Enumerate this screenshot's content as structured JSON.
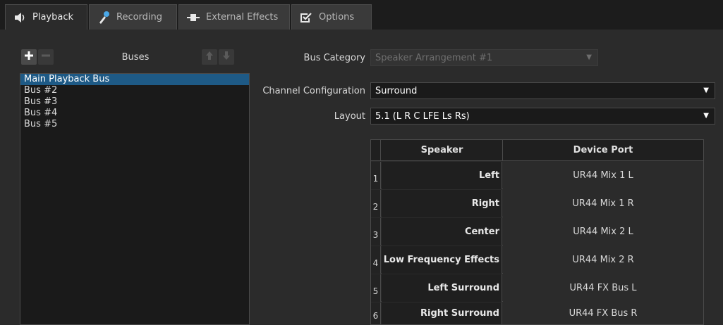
{
  "tabs": [
    {
      "label": "Playback",
      "icon": "speaker-icon",
      "active": true
    },
    {
      "label": "Recording",
      "icon": "microphone-icon",
      "active": false
    },
    {
      "label": "External Effects",
      "icon": "plug-icon",
      "active": false
    },
    {
      "label": "Options",
      "icon": "checkbox-icon",
      "active": false
    }
  ],
  "buses": {
    "label": "Buses",
    "items": [
      "Main Playback Bus",
      "Bus #2",
      "Bus #3",
      "Bus #4",
      "Bus #5"
    ],
    "selected": "Main Playback Bus"
  },
  "form": {
    "bus_category_label": "Bus Category",
    "bus_category_value": "Speaker Arrangement #1",
    "channel_config_label": "Channel Configuration",
    "channel_config_value": "Surround",
    "layout_label": "Layout",
    "layout_value": "5.1 (L R C LFE Ls Rs)"
  },
  "table": {
    "headers": [
      "Speaker",
      "Device Port"
    ],
    "rows": [
      {
        "num": "1",
        "speaker": "Left",
        "port": "UR44 Mix 1 L"
      },
      {
        "num": "2",
        "speaker": "Right",
        "port": "UR44 Mix 1 R"
      },
      {
        "num": "3",
        "speaker": "Center",
        "port": "UR44 Mix 2 L"
      },
      {
        "num": "4",
        "speaker": "Low Frequency Effects",
        "port": "UR44 Mix 2 R"
      },
      {
        "num": "5",
        "speaker": "Left Surround",
        "port": "UR44 FX Bus L"
      },
      {
        "num": "6",
        "speaker": "Right Surround",
        "port": "UR44 FX Bus R"
      }
    ]
  },
  "colors": {
    "accent": "#1e5a86",
    "mic_accent": "#4aa8e8",
    "background": "#2b2b2b"
  }
}
